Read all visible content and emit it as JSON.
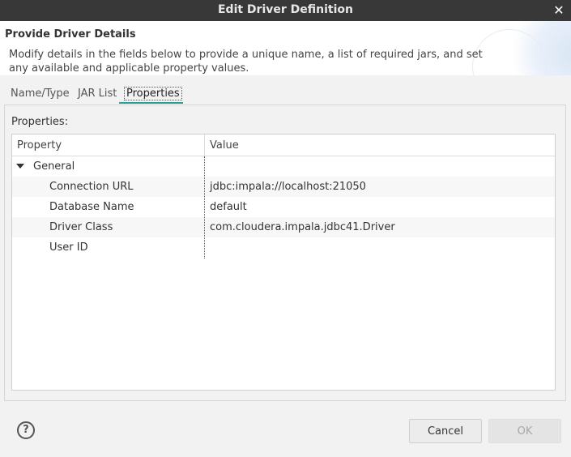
{
  "window": {
    "title": "Edit Driver Definition"
  },
  "header": {
    "title": "Provide Driver Details",
    "description": "Modify details in the fields below to provide a unique name, a list of required jars, and set any available and applicable property values."
  },
  "tabs": [
    {
      "label": "Name/Type"
    },
    {
      "label": "JAR List"
    },
    {
      "label": "Properties",
      "active": true
    }
  ],
  "properties": {
    "label": "Properties:",
    "columns": [
      "Property",
      "Value"
    ],
    "group": "General",
    "rows": [
      {
        "property": "Connection URL",
        "value": "jdbc:impala://localhost:21050"
      },
      {
        "property": "Database Name",
        "value": "default"
      },
      {
        "property": "Driver Class",
        "value": "com.cloudera.impala.jdbc41.Driver"
      },
      {
        "property": "User ID",
        "value": ""
      }
    ]
  },
  "footer": {
    "help_icon": "?",
    "cancel_label": "Cancel",
    "ok_label": "OK"
  },
  "colors": {
    "accent": "#2aa198",
    "titlebar": "#383838"
  }
}
